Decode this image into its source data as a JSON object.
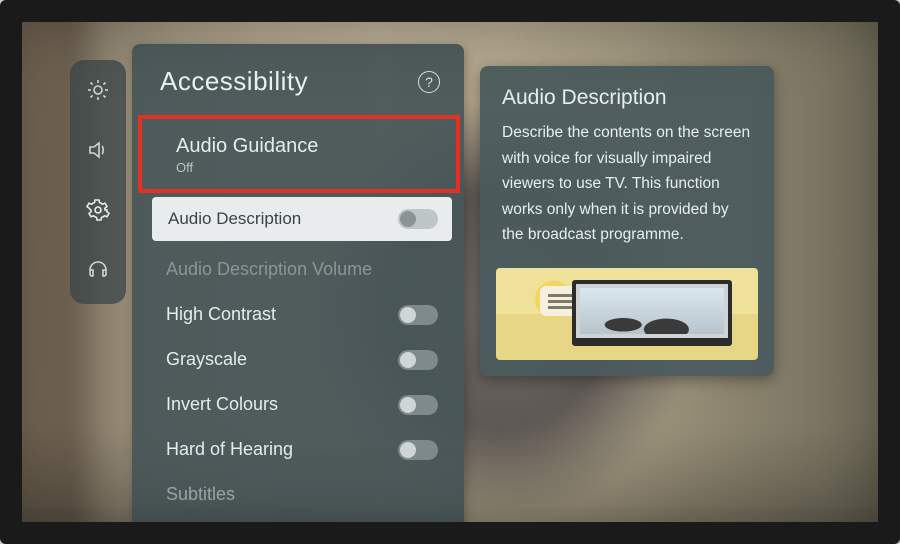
{
  "panel": {
    "title": "Accessibility",
    "help_glyph": "?"
  },
  "rail": {
    "items": [
      {
        "name": "brightness-icon"
      },
      {
        "name": "sound-icon"
      },
      {
        "name": "settings-icon",
        "active": true
      },
      {
        "name": "support-icon"
      }
    ]
  },
  "items": {
    "audio_guidance": {
      "label": "Audio Guidance",
      "value": "Off"
    },
    "audio_description": {
      "label": "Audio Description"
    },
    "audio_description_volume": {
      "label": "Audio Description Volume"
    },
    "high_contrast": {
      "label": "High Contrast"
    },
    "grayscale": {
      "label": "Grayscale"
    },
    "invert_colours": {
      "label": "Invert Colours"
    },
    "hard_of_hearing": {
      "label": "Hard of Hearing"
    },
    "subtitles": {
      "label": "Subtitles"
    }
  },
  "detail": {
    "title": "Audio Description",
    "body": "Describe the contents on the screen with voice for visually impaired viewers to use TV. This function works only when it is provided by the broadcast programme."
  }
}
